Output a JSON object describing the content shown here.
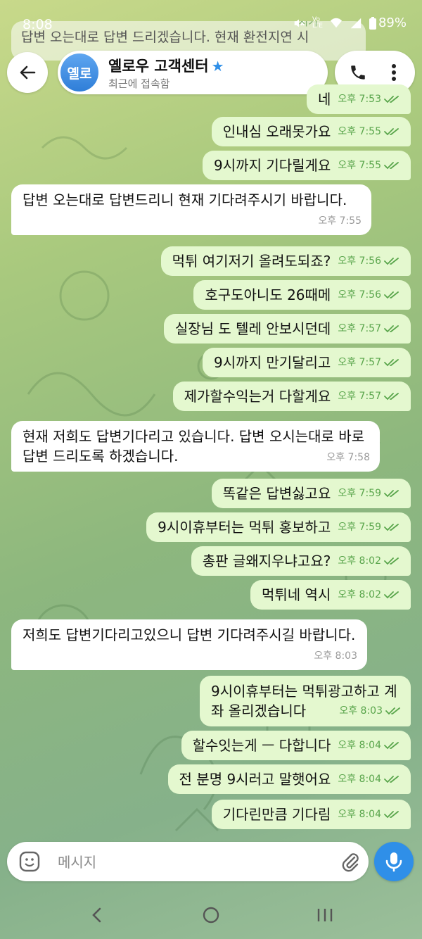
{
  "status": {
    "time": "8:08",
    "battery": "89%"
  },
  "header": {
    "avatar_text": "옐로",
    "title": "옐로우 고객센터",
    "subtitle": "최근에 접속함"
  },
  "top_partial": {
    "text": "답변 오는대로 답변 드리겠습니다. 현재 환전지연 시",
    "partial_time": "시거"
  },
  "messages": [
    {
      "dir": "out",
      "text": "네",
      "time": "오후 7:53"
    },
    {
      "dir": "out",
      "text": "인내심 오래못가요",
      "time": "오후 7:55"
    },
    {
      "dir": "out",
      "text": "9시까지 기다릴게요",
      "time": "오후 7:55"
    },
    {
      "dir": "in",
      "text": "답변 오는대로 답변드리니 현재 기다려주시기 바랍니다.",
      "time": "오후 7:55"
    },
    {
      "dir": "out",
      "text": "먹튀 여기저기 올려도되죠?",
      "time": "오후 7:56"
    },
    {
      "dir": "out",
      "text": "호구도아니도 26때메",
      "time": "오후 7:56"
    },
    {
      "dir": "out",
      "text": "실장님 도 텔레 안보시던데",
      "time": "오후 7:57"
    },
    {
      "dir": "out",
      "text": "9시까지 만기달리고",
      "time": "오후 7:57"
    },
    {
      "dir": "out",
      "text": "제가할수익는거 다할게요",
      "time": "오후 7:57"
    },
    {
      "dir": "in",
      "text": "현재 저희도 답변기다리고 있습니다. 답변 오시는대로 바로 답변 드리도록 하겠습니다.",
      "time": "오후 7:58"
    },
    {
      "dir": "out",
      "text": "똑같은 답변싫고요",
      "time": "오후 7:59"
    },
    {
      "dir": "out",
      "text": "9시이휴부터는 먹튀 홍보하고",
      "time": "오후 7:59"
    },
    {
      "dir": "out",
      "text": "총판 글왜지우냐고요?",
      "time": "오후 8:02"
    },
    {
      "dir": "out",
      "text": "먹튀네 역시",
      "time": "오후 8:02"
    },
    {
      "dir": "in",
      "text": "저희도 답변기다리고있으니 답변 기다려주시길 바랍니다.",
      "time": "오후 8:03"
    },
    {
      "dir": "out",
      "text": "9시이휴부터는 먹튀광고하고 계좌 올리겠습니다",
      "time": "오후 8:03"
    },
    {
      "dir": "out",
      "text": "할수잇는게 ㅡ 다합니다",
      "time": "오후 8:04"
    },
    {
      "dir": "out",
      "text": "전 분명 9시러고 말햇어요",
      "time": "오후 8:04"
    },
    {
      "dir": "out",
      "text": "기다린만큼 기다림",
      "time": "오후 8:04"
    }
  ],
  "composer": {
    "placeholder": "메시지",
    "value": ""
  },
  "colors": {
    "accent": "#2f8fe8",
    "outgoing_bubble": "#e4f8cf",
    "incoming_bubble": "#ffffff",
    "tick": "#59a54b"
  }
}
